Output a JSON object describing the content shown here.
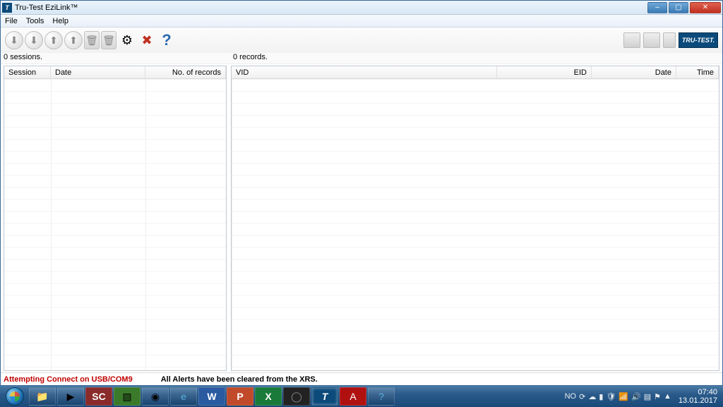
{
  "window": {
    "title": "Tru-Test EziLink™",
    "icon_letter": "T"
  },
  "menu": {
    "file": "File",
    "tools": "Tools",
    "help": "Help"
  },
  "toolbar": {
    "help_glyph": "?",
    "brand": "TRU-TEST."
  },
  "counts": {
    "sessions": "0 sessions.",
    "records": "0 records."
  },
  "left_panel": {
    "cols": {
      "session": "Session",
      "date": "Date",
      "records": "No. of records"
    }
  },
  "right_panel": {
    "cols": {
      "vid": "VID",
      "eid": "EID",
      "date": "Date",
      "time": "Time"
    }
  },
  "status": {
    "connect": "Attempting Connect on USB/COM9",
    "alerts": "All Alerts have been cleared from the XRS."
  },
  "taskbar": {
    "lang": "NO",
    "time": "07:40",
    "date": "13.01.2017"
  }
}
